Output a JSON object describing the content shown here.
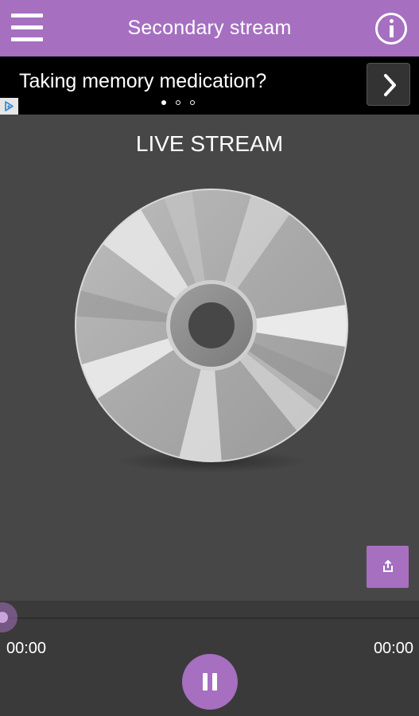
{
  "app_bar": {
    "title": "Secondary stream",
    "menu_icon": "hamburger-menu-icon",
    "info_icon": "info-icon",
    "color": "#a66fc0"
  },
  "ad": {
    "text": "Taking memory medication?",
    "next_icon": "chevron-right-icon",
    "choices_icon": "adchoices-icon",
    "pagination": {
      "count": 3,
      "active": 1
    }
  },
  "main": {
    "stream_label": "LIVE STREAM",
    "artwork_icon": "compact-disc-icon",
    "share_icon": "share-icon"
  },
  "player": {
    "elapsed": "00:00",
    "duration": "00:00",
    "progress_fraction": 0,
    "play_state": "playing",
    "pause_icon": "pause-icon"
  },
  "colors": {
    "accent": "#a66fc0",
    "background": "#474747",
    "player_background": "#3a3a3a",
    "ad_background": "#000000"
  }
}
